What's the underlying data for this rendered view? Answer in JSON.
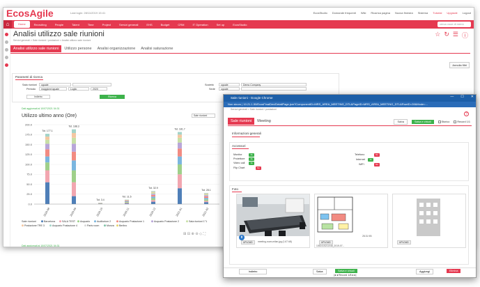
{
  "app": {
    "brand": "EcosAgile",
    "last_login": "Last login: 28/11/2019 15:41",
    "top_links": [
      "EcosStudio",
      "Domande frequenti",
      "Wiki",
      "Ricarica pagina",
      "Nuova finestra",
      "Sistema",
      "Tutorial",
      "Upgrade",
      "Logout"
    ]
  },
  "navbar": {
    "home": "Home",
    "items": [
      "Recruiting",
      "People",
      "Talent",
      "Time",
      "Project",
      "Servizi generali",
      "EHS",
      "Budget",
      "CRM",
      "IT Operation",
      "Set up",
      "EcosStudio"
    ],
    "search_placeholder": "cerca voce di menù"
  },
  "page": {
    "title": "Analisi utilizzo sale riunioni",
    "breadcrumb": "Servizi generali > Sale riunioni / postazioni > Analisi utilizzo sale riunioni",
    "tabs": [
      "Analisi utilizzo sale riunioni",
      "Utilizzo persone",
      "Analisi organizzazione",
      "Analisi saturazione"
    ],
    "annulla_label": "Annulla filtri"
  },
  "filters": {
    "title": "Parametri di ricerca",
    "sala_label": "Sala riunioni",
    "sala_value": "uguale",
    "periodo_label": "Periodo",
    "periodo_op": "maggiore/uguale",
    "periodo_month": "Luglio",
    "periodo_year": "2020",
    "societa_label": "Società",
    "societa_op": "uguale",
    "societa_value": "Demo Company",
    "sede_label": "Sede",
    "sede_op": "uguale",
    "indietro_label": "Indietro",
    "ricerca_label": "Ricerca"
  },
  "chart_meta": {
    "note_top": "Dati aggiornati al 10/07/2021 04:31",
    "note_bottom": "Dati aggiornati al 10/07/2021 04:31",
    "title": "Utilizzo ultimo anno (Ore)",
    "select_value": "Sale riunioni",
    "legend_title": "Sale riunioni",
    "toolbar_icons": "⊞ ⊟ ⊕ ⊖ ◇ ⛶"
  },
  "chart_data": {
    "type": "bar",
    "stacked": true,
    "categories": [
      "2020-08",
      "2020-09",
      "2020-10",
      "2020-11",
      "2020-12",
      "2021-01",
      "2021-02"
    ],
    "ylim": [
      0,
      200
    ],
    "yticks": [
      0,
      25,
      50,
      75,
      100,
      125,
      150,
      175,
      200
    ],
    "totals": [
      177.1,
      188.3,
      3.4,
      11.5,
      32.9,
      181.7,
      28.1
    ],
    "total_labels": [
      "Tot. 177.1",
      "Tot. 188.3",
      "Tot. 3.4",
      "Tot. 11.5",
      "Tot. 32.9",
      "Tot. 181.7",
      "Tot. 28.1"
    ],
    "series": [
      {
        "name": "Barcelona",
        "color": "#4f7fb8",
        "values": [
          55,
          20,
          0.8,
          2,
          6,
          40,
          5
        ]
      },
      {
        "name": "SALA TEST",
        "color": "#f2a6b0",
        "values": [
          30,
          35,
          0.6,
          1.5,
          4,
          35,
          3
        ]
      },
      {
        "name": "Acquario",
        "color": "#9fd08a",
        "values": [
          20,
          30,
          0.5,
          2,
          5,
          25,
          4
        ]
      },
      {
        "name": "Auditorium 2",
        "color": "#7bb6df",
        "values": [
          15,
          25,
          0.4,
          1.5,
          4,
          20,
          3.5
        ]
      },
      {
        "name": "Acquario Postazione 1",
        "color": "#f28b82",
        "values": [
          18,
          22,
          0.4,
          1.5,
          4,
          20,
          4
        ]
      },
      {
        "name": "Acquario Postazione 2",
        "color": "#b9a6d9",
        "values": [
          14,
          20,
          0.3,
          1,
          3,
          15,
          3
        ]
      },
      {
        "name": "Sala riunioni 1°1",
        "color": "#c8e0a6",
        "values": [
          10,
          15,
          0.2,
          1,
          3,
          12,
          2.5
        ]
      },
      {
        "name": "Postazione TRE 3",
        "color": "#f4c7a1",
        "values": [
          8,
          12,
          0.1,
          0.5,
          2,
          8,
          1.6
        ]
      },
      {
        "name": "Acquario Postazione 4",
        "color": "#a4d4c9",
        "values": [
          7.1,
          9.3,
          0.1,
          0.5,
          1.9,
          6.7,
          1.5
        ]
      }
    ],
    "legend_extra": [
      "Paris room",
      "Monza",
      "Berlino"
    ],
    "legend_extra_colors": [
      "#d9d9d9",
      "#7fc2a7",
      "#e6d36b"
    ]
  },
  "popup": {
    "window_title": "Sale riunioni - Google Chrome",
    "url": "Non sicuro | 10.21.1.50/EcosFinalDev/DetailPage.jsm?ComponentID=MRS_AREA_MEETING_DTL&PageID=MRS_AREA_MEETING_DTL&RowID=28&Mode=...",
    "breadcrumb": "Servizi generali > Sale riunioni / postazioni",
    "tabs": [
      "Sale riunioni",
      "Meeting"
    ],
    "salva_label": "Salva",
    "salva_chiudi_label": "Salva e chiudi",
    "storico_label": "Storico",
    "record_label": "Record 1/1",
    "help": "?",
    "info_title": "Informazioni generali",
    "accessori_title": "Accessori",
    "accessori_left": [
      {
        "label": "Monitor",
        "state": "Sì"
      },
      {
        "label": "Proiettore",
        "state": "Sì"
      },
      {
        "label": "Video call",
        "state": "Sì"
      },
      {
        "label": "Flip Chart",
        "state": "No"
      }
    ],
    "accessori_right": [
      {
        "label": "Telefono",
        "state": "No"
      },
      {
        "label": "Internet",
        "state": "Sì"
      },
      {
        "label": "WiFi",
        "state": "No"
      }
    ],
    "foto_title": "Foto",
    "foto_items": [
      {
        "upload": "UPLOAD",
        "name": "meeting-room-milan.jpg (1.67 kB)"
      },
      {
        "upload": "UPLOAD",
        "name": "28.31 KB",
        "name2": "1052415211048_2019-07..."
      },
      {
        "upload": "UPLOAD",
        "name": ""
      }
    ],
    "footer": {
      "indietro_label": "Indietro",
      "salva_label": "Salva",
      "salva_chiudi_label": "Salva e chiudi",
      "aggiungi_label": "Aggiungi",
      "elimina_label": "Elimina",
      "pager_text": "Record 1/8"
    }
  }
}
